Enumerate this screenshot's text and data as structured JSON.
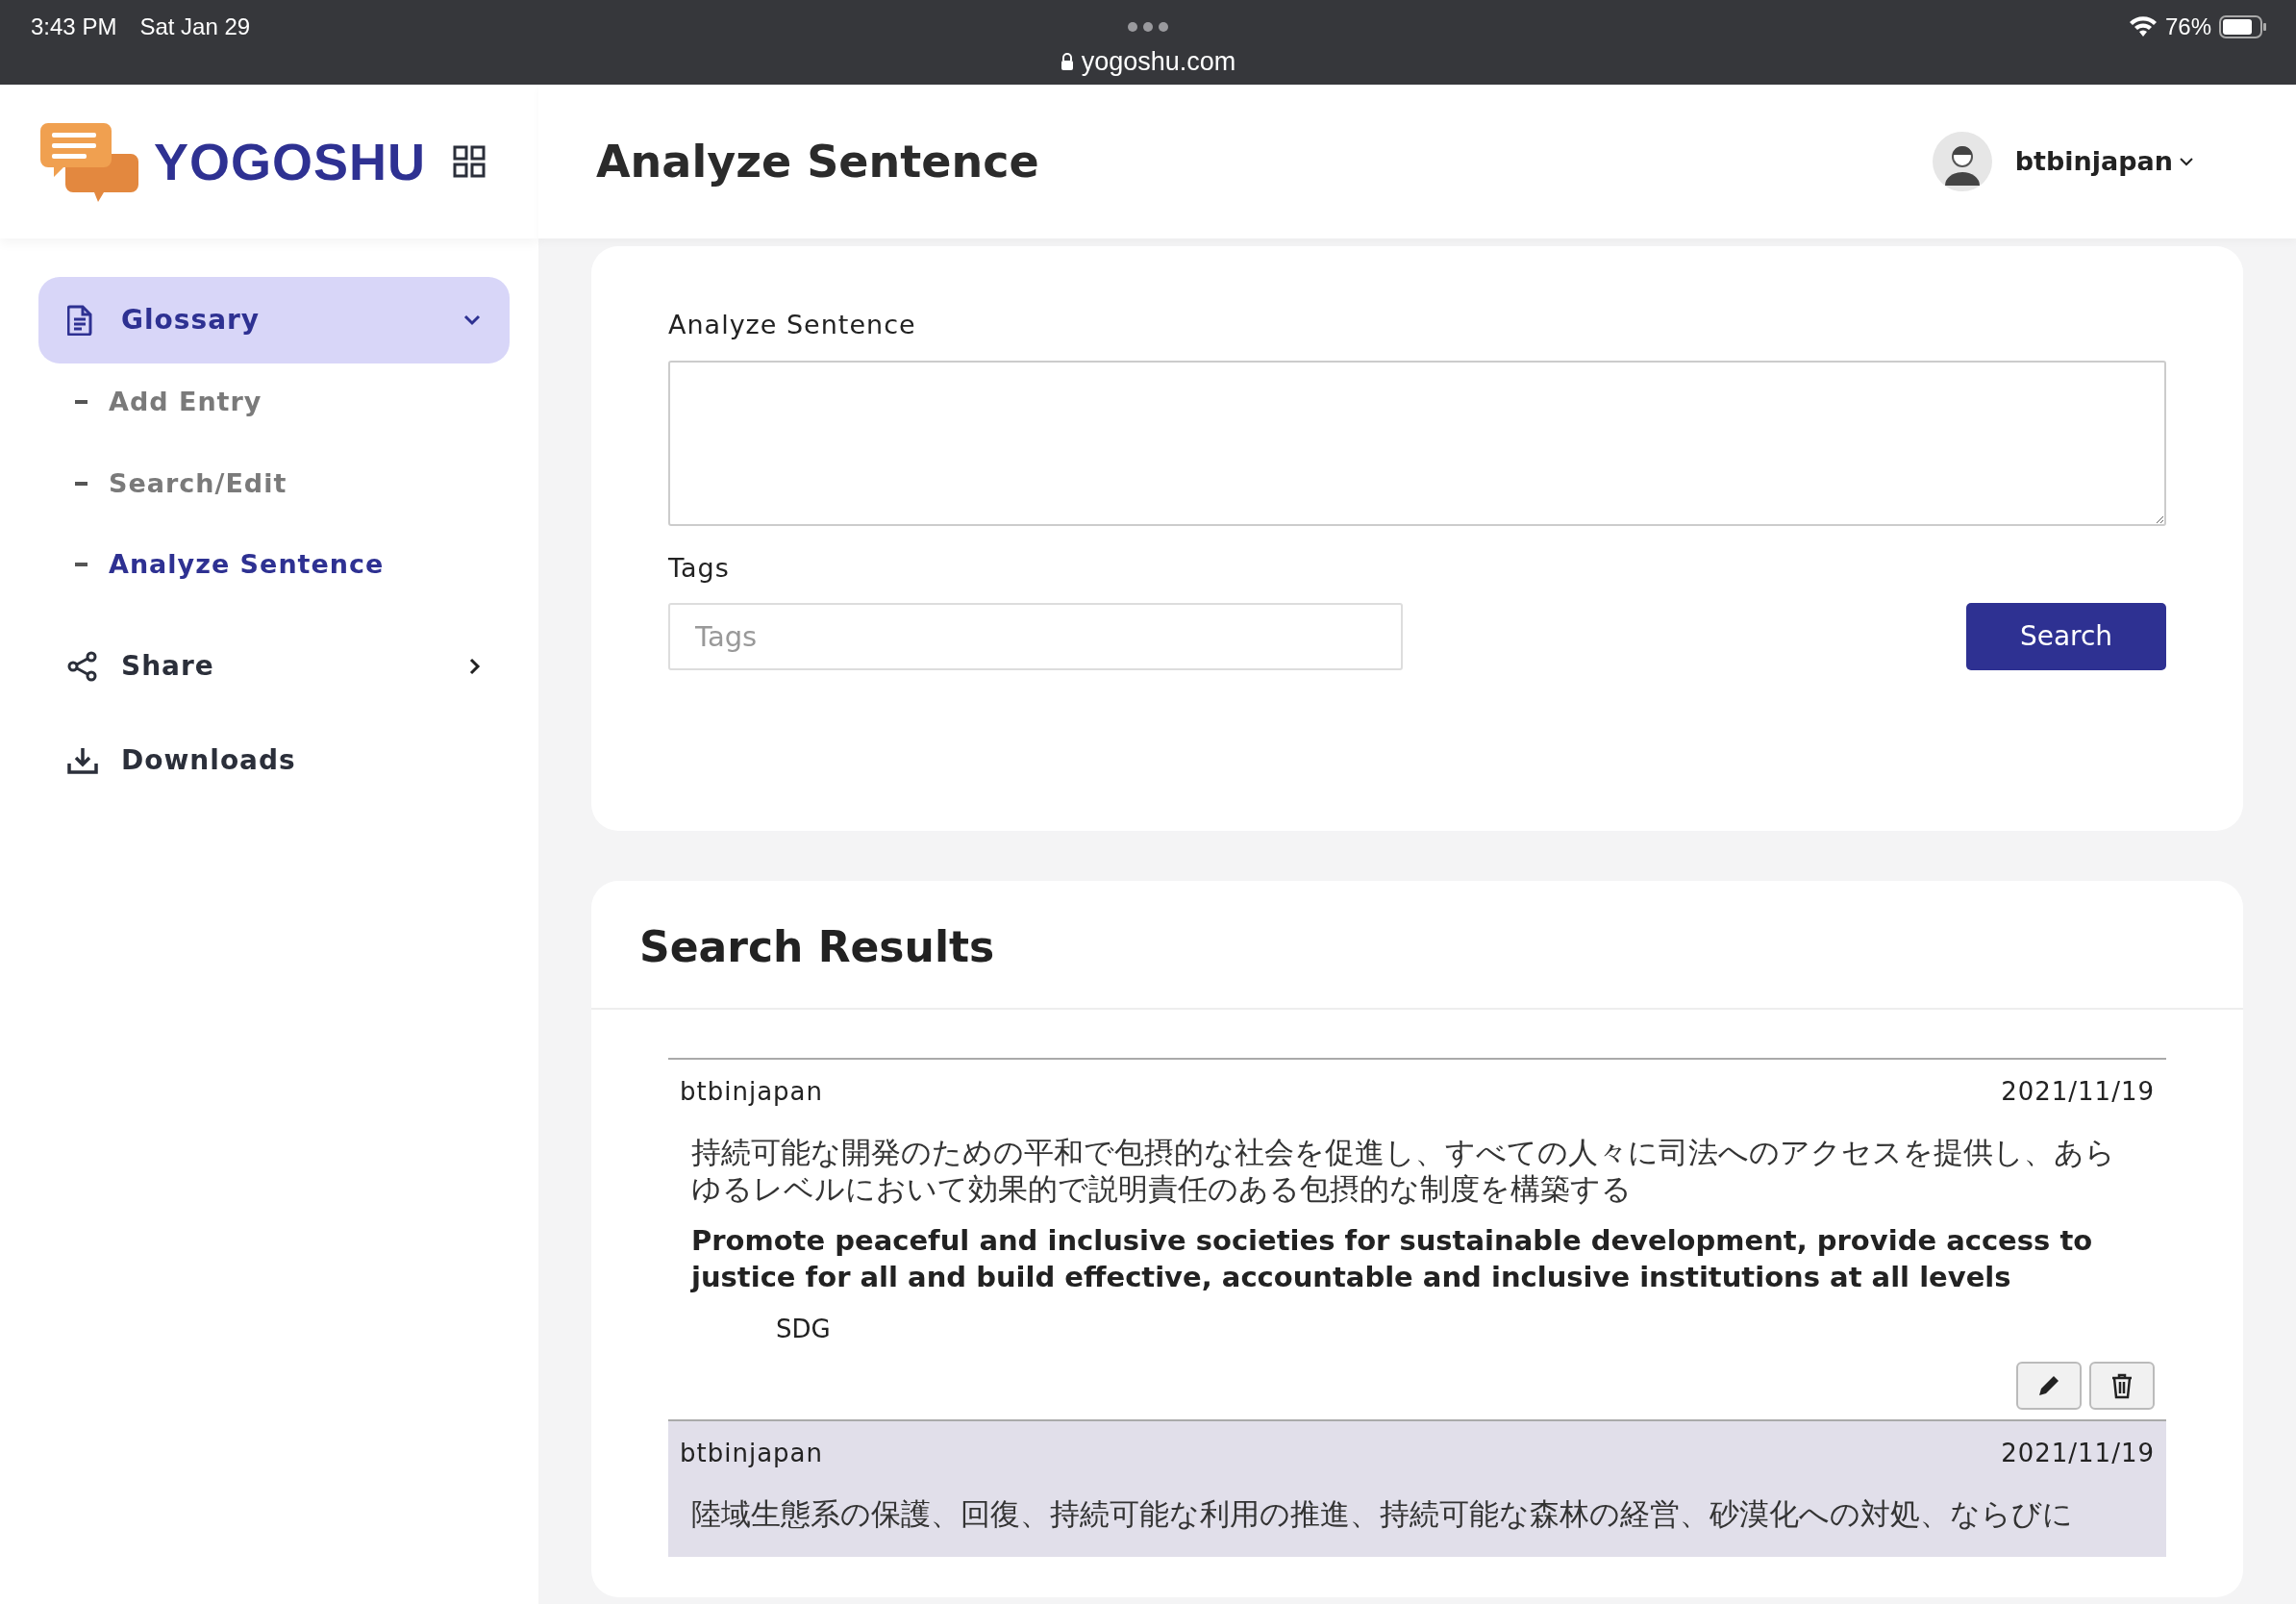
{
  "status_bar": {
    "time": "3:43 PM",
    "date": "Sat Jan 29",
    "url": "yogoshu.com",
    "battery": "76%"
  },
  "brand": {
    "name": "YOGOSHU"
  },
  "header": {
    "title": "Analyze Sentence",
    "user": "btbinjapan"
  },
  "sidebar": {
    "items": [
      {
        "label": "Glossary",
        "kind": "group",
        "selected": true,
        "expanded": true,
        "children": [
          {
            "label": "Add Entry",
            "selected": false
          },
          {
            "label": "Search/Edit",
            "selected": false
          },
          {
            "label": "Analyze Sentence",
            "selected": true
          }
        ]
      },
      {
        "label": "Share",
        "kind": "group",
        "selected": false,
        "expanded": false
      },
      {
        "label": "Downloads",
        "kind": "link",
        "selected": false
      }
    ]
  },
  "form": {
    "sentence_label": "Analyze Sentence",
    "tags_label": "Tags",
    "tags_placeholder": "Tags",
    "search_button": "Search"
  },
  "results": {
    "title": "Search Results",
    "entries": [
      {
        "user": "btbinjapan",
        "date": "2021/11/19",
        "japanese": "持続可能な開発のための平和で包摂的な社会を促進し、すべての人々に司法へのアクセスを提供し、あらゆるレベルにおいて効果的で説明責任のある包摂的な制度を構築する",
        "english": "Promote peaceful and inclusive societies for sustainable development, provide access to justice for all and build effective, accountable and inclusive institutions at all levels",
        "tags": [
          "SDG"
        ],
        "selected": false,
        "has_actions": true
      },
      {
        "user": "btbinjapan",
        "date": "2021/11/19",
        "japanese": "陸域生態系の保護、回復、持続可能な利用の推進、持続可能な森林の経営、砂漠化への対処、ならびに",
        "selected": true,
        "has_actions": false
      }
    ]
  }
}
